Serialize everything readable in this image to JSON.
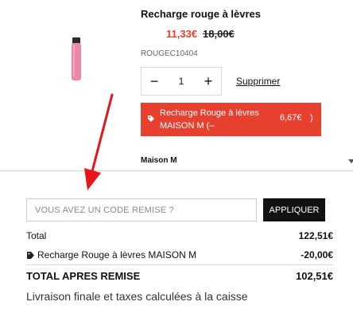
{
  "product": {
    "name": "Recharge rouge à lèvres",
    "price_sale": "11,33€",
    "price_old": "18,00€",
    "sku": "ROUGEC10404",
    "quantity": "1",
    "qty_minus": "−",
    "qty_plus": "+",
    "remove_label": "Supprimer",
    "brand": "Maison M"
  },
  "discount_chip": {
    "name": "Recharge Rouge à lèvres MAISON M (–",
    "amount": "6,67€",
    "paren": ")",
    "icon": "tag-icon"
  },
  "discount_form": {
    "placeholder": "VOUS AVEZ UN CODE REMISE ?",
    "button_label": "APPLIQUER"
  },
  "summary": {
    "total_label": "Total",
    "total_value": "122,51€",
    "discount_label": "Recharge Rouge à lèvres MAISON M",
    "discount_value": "-20,00€",
    "grand_label": "TOTAL APRES REMISE",
    "grand_value": "102,51€",
    "footnote": "Livraison finale et taxes calculées à la caisse"
  },
  "colors": {
    "accent": "#e8402e",
    "button_dark": "#111111",
    "arrow": "#e8141c"
  }
}
